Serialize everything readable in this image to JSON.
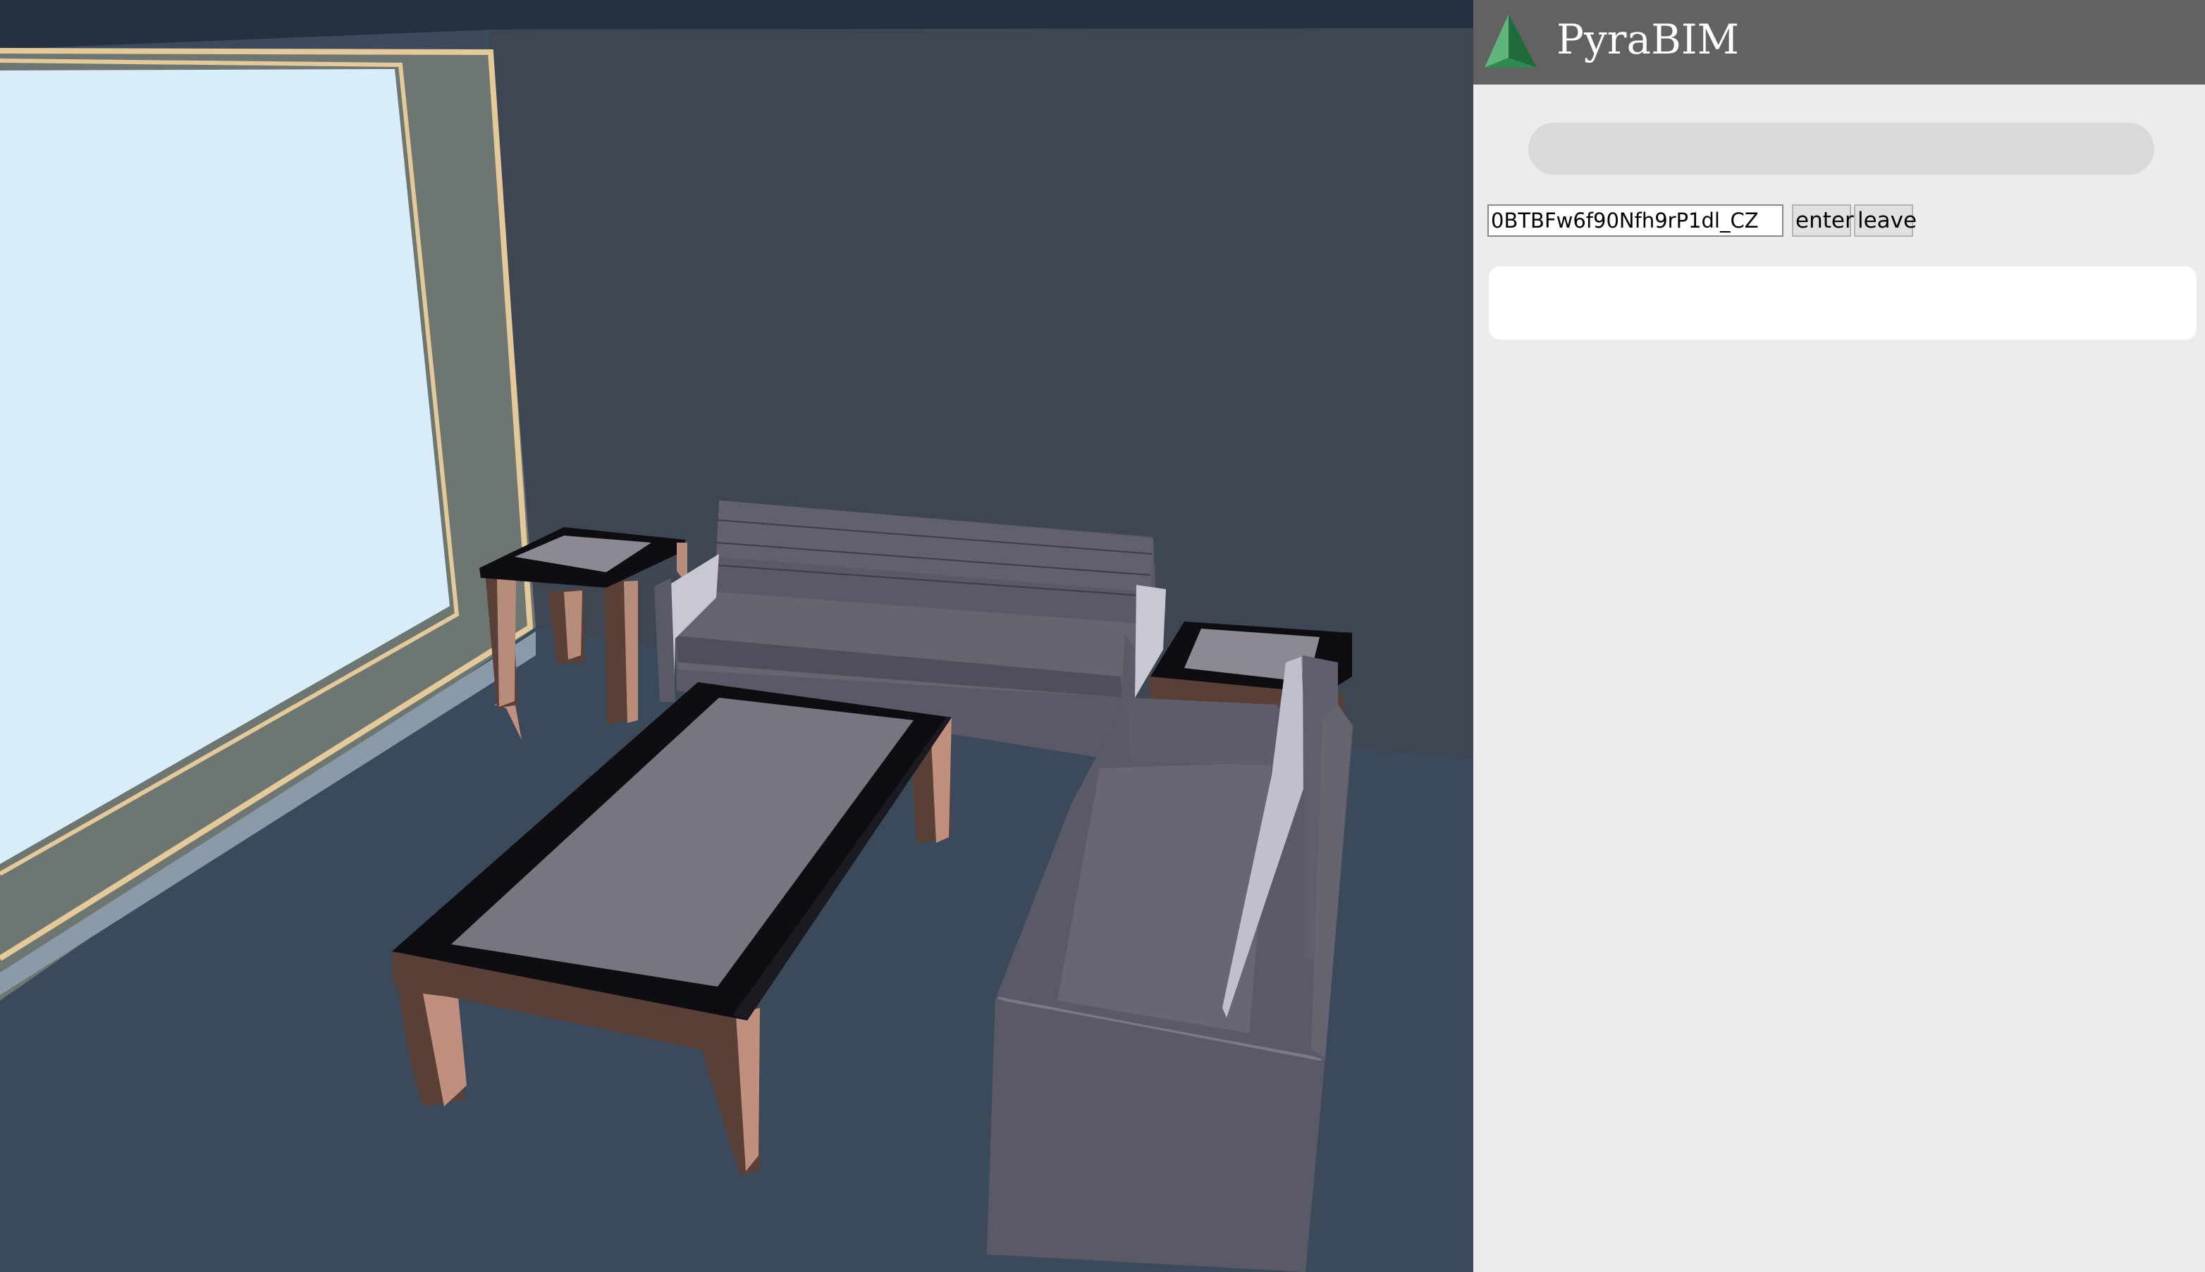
{
  "app": {
    "title": "PyraBIM",
    "logo_icon": "pyramid-logo-icon",
    "accent_color": "#2e8a4e",
    "header_color": "#626262"
  },
  "controls": {
    "guid_value": "0BTBFw6f90Nfh9rP1dl_CZ",
    "enter_label": "enter",
    "leave_label": "leave"
  },
  "status": {
    "progress_fraction": 0,
    "output_text": ""
  },
  "scene": {
    "description_objects": [
      "window",
      "wall",
      "floor",
      "sofa",
      "loveseat",
      "coffee-table",
      "side-table-left",
      "side-table-right"
    ],
    "colors": {
      "wall": "#3e4653",
      "floor": "#3c4a5b",
      "furniture": "#5a5967",
      "table_frame": "#0e0e12",
      "table_glass": "#77757f",
      "table_legs": "#5a3f36",
      "window_glass": "#d8edf8"
    }
  }
}
